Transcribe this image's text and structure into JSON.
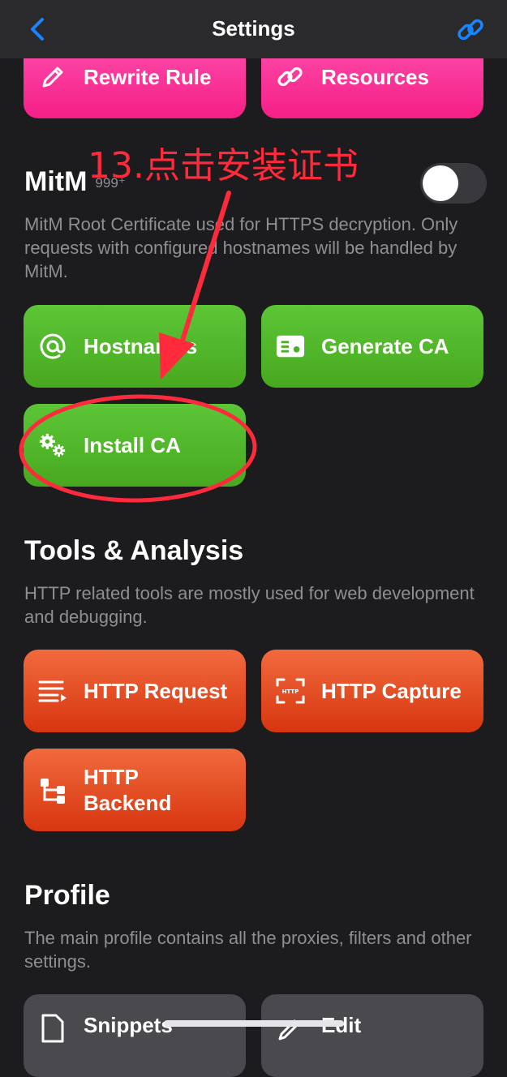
{
  "navbar": {
    "title": "Settings",
    "back_icon": "chevron-left-icon",
    "link_icon": "link-icon",
    "accent": "#1a84ff"
  },
  "top_cards": [
    {
      "label": "Rewrite Rule",
      "icon": "pencil-icon"
    },
    {
      "label": "Resources",
      "icon": "link-icon"
    }
  ],
  "mitm": {
    "title": "MitM",
    "badge": "999⁺",
    "description": "MitM Root Certificate used for HTTPS decryption. Only requests with configured hostnames will be handled by MitM.",
    "toggle_on": false,
    "cards": [
      {
        "label": "Hostnames",
        "icon": "at-icon"
      },
      {
        "label": "Generate CA",
        "icon": "id-card-icon"
      },
      {
        "label": "Install CA",
        "icon": "gears-icon"
      }
    ]
  },
  "annotation": {
    "text": "13.点击安装证书",
    "color": "#ff2a3c"
  },
  "tools": {
    "title": "Tools & Analysis",
    "description": "HTTP related tools are mostly used for web development and debugging.",
    "cards": [
      {
        "label": "HTTP Request",
        "icon": "list-arrow-icon"
      },
      {
        "label": "HTTP Capture",
        "icon": "capture-frame-icon"
      },
      {
        "label_line1": "HTTP",
        "label_line2": "Backend",
        "icon": "tree-icon"
      }
    ]
  },
  "profile": {
    "title": "Profile",
    "description": "The main profile contains all the proxies, filters and other settings.",
    "cards": [
      {
        "label": "Snippets",
        "icon": "document-icon"
      },
      {
        "label": "Edit",
        "icon": "edit-icon"
      }
    ]
  },
  "colors": {
    "pink": "#f51f86",
    "green": "#4cae22",
    "orange": "#e24a1f",
    "background": "#1c1c1e"
  }
}
